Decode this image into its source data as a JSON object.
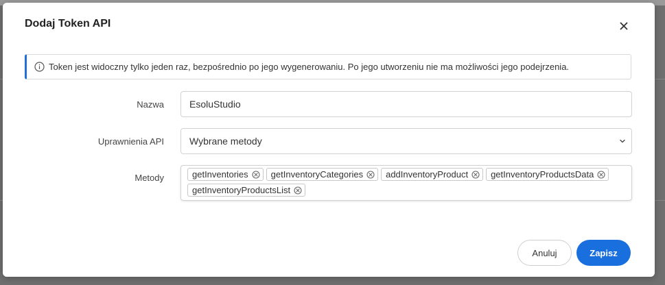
{
  "modal": {
    "title": "Dodaj Token API",
    "info_text": "Token jest widoczny tylko jeden raz, bezpośrednio po jego wygenerowaniu. Po jego utworzeniu nie ma możliwości jego podejrzenia."
  },
  "form": {
    "name": {
      "label": "Nazwa",
      "value": "EsoluStudio"
    },
    "permissions": {
      "label": "Uprawnienia API",
      "selected": "Wybrane metody"
    },
    "methods": {
      "label": "Metody",
      "tags": [
        "getInventories",
        "getInventoryCategories",
        "addInventoryProduct",
        "getInventoryProductsData",
        "getInventoryProductsList"
      ]
    }
  },
  "actions": {
    "cancel_label": "Anuluj",
    "save_label": "Zapisz"
  },
  "colors": {
    "accent": "#1a6fdf",
    "info_border": "#1e6fd9"
  },
  "icons": {
    "close": "close-icon",
    "info": "info-icon",
    "dropdown": "chevron-down-icon",
    "tag_remove": "remove-tag-icon"
  }
}
